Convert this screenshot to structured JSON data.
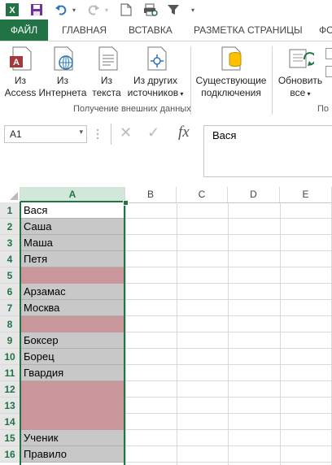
{
  "tabs": [
    "ФАЙЛ",
    "ГЛАВНАЯ",
    "ВСТАВКА",
    "РАЗМЕТКА СТРАНИЦЫ",
    "ФО"
  ],
  "ribbon": {
    "buttons": [
      {
        "line1": "Из",
        "line2": "Access"
      },
      {
        "line1": "Из",
        "line2": "Интернета"
      },
      {
        "line1": "Из",
        "line2": "текста"
      },
      {
        "line1": "Из других",
        "line2": "источников"
      },
      {
        "line1": "Существующие",
        "line2": "подключения"
      },
      {
        "line1": "Обновить",
        "line2": "все"
      }
    ],
    "group_label": "Получение внешних данных",
    "group_label_partial": "По"
  },
  "formula_bar": {
    "name_box": "A1",
    "fx": "fx",
    "content": "Вася"
  },
  "columns": [
    "A",
    "B",
    "C",
    "D",
    "E"
  ],
  "rows": [
    {
      "num": "1",
      "value": "Вася",
      "fill": "white"
    },
    {
      "num": "2",
      "value": "Саша",
      "fill": "gray"
    },
    {
      "num": "3",
      "value": "Маша",
      "fill": "gray"
    },
    {
      "num": "4",
      "value": "Петя",
      "fill": "gray"
    },
    {
      "num": "5",
      "value": "",
      "fill": "pink"
    },
    {
      "num": "6",
      "value": "Арзамас",
      "fill": "gray"
    },
    {
      "num": "7",
      "value": "Москва",
      "fill": "gray"
    },
    {
      "num": "8",
      "value": "",
      "fill": "pink"
    },
    {
      "num": "9",
      "value": "Боксер",
      "fill": "gray"
    },
    {
      "num": "10",
      "value": "Борец",
      "fill": "gray"
    },
    {
      "num": "11",
      "value": "Гвардия",
      "fill": "gray"
    },
    {
      "num": "12",
      "value": "",
      "fill": "pink"
    },
    {
      "num": "13",
      "value": "",
      "fill": "pink"
    },
    {
      "num": "14",
      "value": "",
      "fill": "pink"
    },
    {
      "num": "15",
      "value": "Ученик",
      "fill": "gray"
    },
    {
      "num": "16",
      "value": "Правило",
      "fill": "gray"
    }
  ],
  "colors": {
    "excel_green": "#217346",
    "gray_fill": "#c8c8c8",
    "pink_fill": "#c9969c"
  }
}
